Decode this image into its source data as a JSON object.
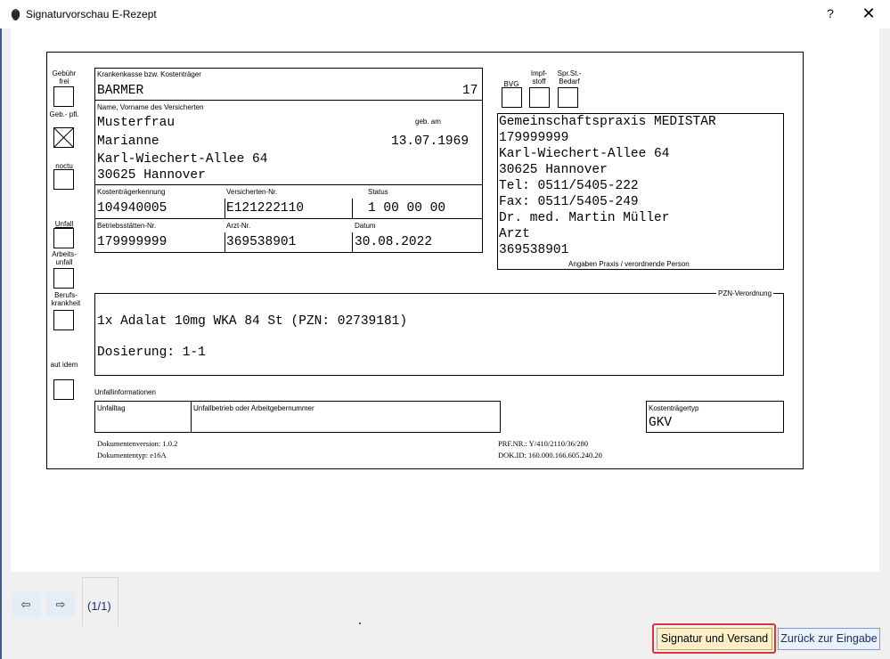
{
  "window": {
    "title": "Signaturvorschau E-Rezept",
    "help": "?",
    "close": "✕"
  },
  "form": {
    "left_checks": {
      "gebuehr_frei": "Gebühr frei",
      "geb_pfl": "Geb.- pfl.",
      "noctu": "noctu",
      "unfall": "Unfall",
      "arbeitsunfall": "Arbeits- unfall",
      "berufskrankheit": "Berufs- krankheit",
      "aut_idem": "aut idem"
    },
    "top_checks": {
      "bvg": "BVG",
      "impfstoff": "Impf- stoff",
      "spr_st_bedarf": "Spr.St.- Bedarf"
    },
    "insurer": {
      "label": "Krankenkasse bzw. Kostenträger",
      "value": "BARMER",
      "number": "17"
    },
    "patient": {
      "label": "Name, Vorname des Versicherten",
      "dob_label": "geb. am",
      "lastname": "Musterfrau",
      "firstname": "Marianne",
      "dob": "13.07.1969",
      "street": "Karl-Wiechert-Allee 64",
      "city": "30625 Hannover"
    },
    "ids": {
      "kostentraeger_label": "Kostenträgerkennung",
      "kostentraeger": "104940005",
      "versicherten_label": "Versicherten-Nr.",
      "versicherten": "E121222110",
      "status_label": "Status",
      "status": "1 00 00 00",
      "bsnr_label": "Betriebsstätten-Nr.",
      "bsnr": "179999999",
      "lanr_label": "Arzt-Nr.",
      "lanr": "369538901",
      "datum_label": "Datum",
      "datum": "30.08.2022"
    },
    "practice": {
      "line1": "Gemeinschaftspraxis MEDISTAR",
      "line2": "179999999",
      "line3": "Karl-Wiechert-Allee 64",
      "line4": "30625 Hannover",
      "line5": "Tel: 0511/5405-222",
      "line6": "Fax: 0511/5405-249",
      "line7": "Dr. med. Martin Müller",
      "line8": "Arzt",
      "line9": "369538901",
      "caption": "Angaben Praxis / verordnende Person"
    },
    "prescription": {
      "label": "PZN-Verordnung",
      "line1": "1x Adalat 10mg WKA 84 St (PZN: 02739181)",
      "line2": "Dosierung: 1-1"
    },
    "accident": {
      "title": "Unfallinformationen",
      "tag_label": "Unfalltag",
      "betrieb_label": "Unfallbetrieb oder Arbeitgebernummer",
      "kt_label": "Kostenträgertyp",
      "kt_value": "GKV"
    },
    "footer": {
      "docversion": "Dokumentenversion: 1.0.2",
      "doctype": "Dokumententyp: e16A",
      "prf": "PRF.NR.: Y/410/2110/36/280",
      "dokid": "DOK.ID: 160.000.166.605.240.20"
    }
  },
  "bottom": {
    "prev": "⇦",
    "next": "⇨",
    "page": "(1/1)",
    "sign_button": "Signatur und Versand",
    "back_button": "Zurück zur Eingabe"
  },
  "colors": {
    "highlight": "#d9353a",
    "sign_bg": "#fdf0c8",
    "back_bg": "#eaf1fb"
  }
}
